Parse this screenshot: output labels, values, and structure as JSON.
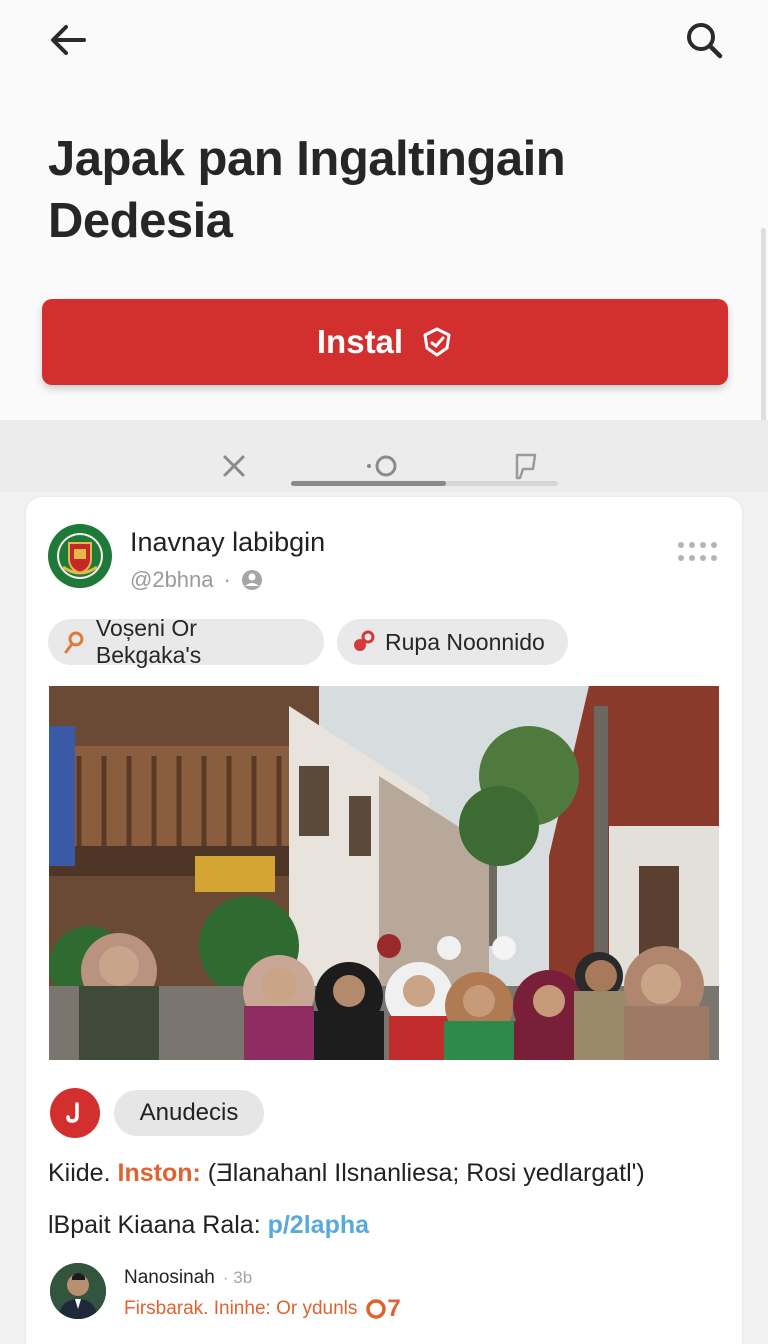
{
  "header": {
    "back_icon": "arrow-left-icon",
    "search_icon": "search-icon",
    "title": "Japak pan  Ingaltingain Dedesia"
  },
  "install_button": {
    "label": "Instal",
    "icon": "tag-check-icon",
    "color": "#d32f2f"
  },
  "tabs": [
    {
      "icon": "close-icon"
    },
    {
      "icon": "circle-icon"
    },
    {
      "icon": "bookmark-icon"
    }
  ],
  "tab_indicator": {
    "progress": 0.58
  },
  "post": {
    "author": "Inavnay labibgin",
    "handle": "@2bhna",
    "chips": [
      {
        "label": "Voșeni Or Bekgaka's",
        "icon": "hook-icon"
      },
      {
        "label": "Rupa Noonnido",
        "icon": "link-icon"
      }
    ],
    "photo_alt": "street-photo",
    "community_chip": "Anudecis",
    "line1_prefix": "Kiide.",
    "line1_highlight": "Inston:",
    "line1_rest": "(Ǝlanahanl Ilsnanliesa;  Rosi yedlargatl')",
    "line2_prefix": "lBpait Kiaana Rala:",
    "line2_link": "p/2lapha"
  },
  "comment": {
    "name": "Nanosinah",
    "time": "3b",
    "text": "Firsbarak. Ininhe: Or ydunls",
    "count": "7"
  },
  "colors": {
    "accent": "#d32f2f",
    "highlight": "#e0622f",
    "link": "#5aaad9"
  }
}
